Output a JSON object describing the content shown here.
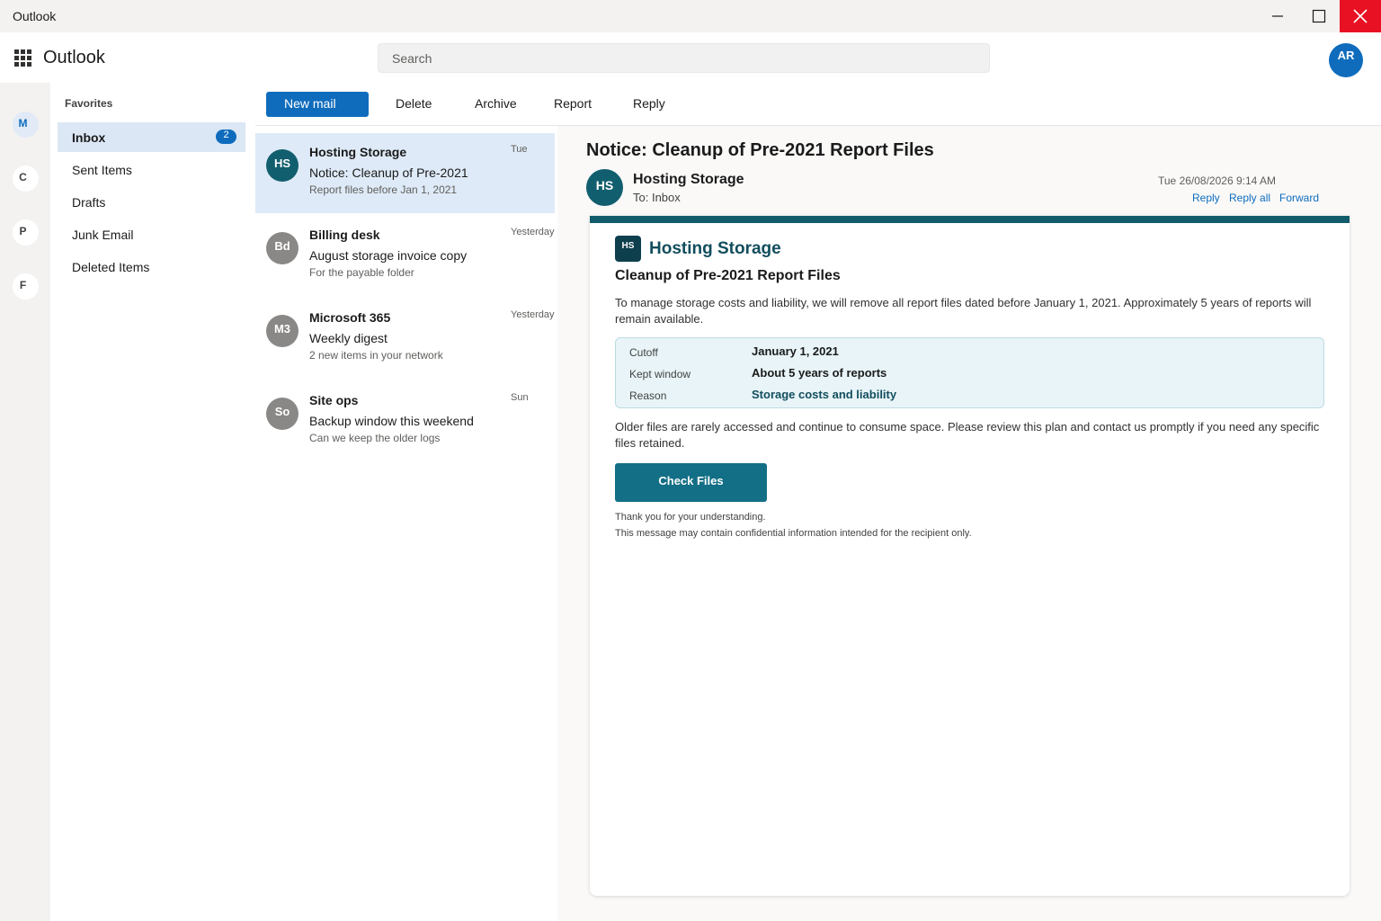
{
  "window": {
    "title": "Outlook"
  },
  "header": {
    "brand": "Outlook",
    "search_placeholder": "Search",
    "user_initials": "AR"
  },
  "rail": [
    {
      "letter": "M",
      "active": true
    },
    {
      "letter": "C",
      "active": false
    },
    {
      "letter": "P",
      "active": false
    },
    {
      "letter": "F",
      "active": false
    }
  ],
  "folders": {
    "section_title": "Favorites",
    "items": [
      {
        "label": "Inbox",
        "badge": "2",
        "active": true
      },
      {
        "label": "Sent Items"
      },
      {
        "label": "Drafts"
      },
      {
        "label": "Junk Email"
      },
      {
        "label": "Deleted Items"
      }
    ]
  },
  "toolbar": {
    "new_mail": "New mail",
    "delete": "Delete",
    "archive": "Archive",
    "report": "Report",
    "reply": "Reply"
  },
  "messages": [
    {
      "initials": "HS",
      "sender": "Hosting Storage",
      "subject": "Notice: Cleanup of Pre-2021",
      "preview": "Report files before Jan 1, 2021",
      "date": "Tue",
      "avatar_color": "#115e6e",
      "selected": true
    },
    {
      "initials": "Bd",
      "sender": "Billing desk",
      "subject": "August storage invoice copy",
      "preview": "For the payable folder",
      "date": "Yesterday",
      "avatar_color": "#8a8886"
    },
    {
      "initials": "M3",
      "sender": "Microsoft 365",
      "subject": "Weekly digest",
      "preview": "2 new items in your network",
      "date": "Yesterday",
      "avatar_color": "#8a8886"
    },
    {
      "initials": "So",
      "sender": "Site ops",
      "subject": "Backup window this weekend",
      "preview": "Can we keep the older logs",
      "date": "Sun",
      "avatar_color": "#8a8886"
    }
  ],
  "reading": {
    "subject": "Notice: Cleanup of Pre-2021 Report Files",
    "sender_initials": "HS",
    "sender": "Hosting Storage",
    "to": "To: Inbox",
    "date": "Tue 26/08/2026 9:14 AM",
    "actions": {
      "reply": "Reply",
      "reply_all": "Reply all",
      "forward": "Forward"
    },
    "body": {
      "logo_text": "HS",
      "brand": "Hosting Storage",
      "heading": "Cleanup of Pre-2021 Report Files",
      "intro": "To manage storage costs and liability, we will remove all report files dated before January 1, 2021. Approximately 5 years of reports will remain available.",
      "details": [
        {
          "label": "Cutoff",
          "value": "January 1, 2021"
        },
        {
          "label": "Kept window",
          "value": "About 5 years of reports"
        },
        {
          "label": "Reason",
          "value": "Storage costs and liability"
        }
      ],
      "followup": "Older files are rarely accessed and continue to consume space. Please review this plan and contact us promptly if you need any specific files retained.",
      "button": "Check Files",
      "thanks": "Thank you for your understanding.",
      "disclaimer": "This message may contain confidential information intended for the recipient only."
    }
  },
  "colors": {
    "accent": "#0f6cbd",
    "brand_teal": "#135c6c",
    "button_teal": "#136f86",
    "close_red": "#e81123"
  }
}
